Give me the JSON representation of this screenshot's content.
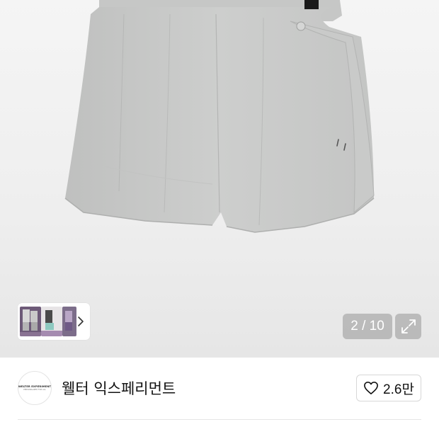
{
  "gallery": {
    "counter": "2 / 10",
    "thumbnail_strip": {
      "thumb_count": 3
    }
  },
  "brand": {
    "name": "웰터 익스페리먼트",
    "logo_line1": "WELTER EXPERIMENT",
    "logo_line2": "PERSONALIZED FOR ALL"
  },
  "like": {
    "count": "2.6만"
  },
  "colors": {
    "gallery_bg": "#eeeeee",
    "overlay_button": "#9a9a9a",
    "text": "#111111"
  }
}
